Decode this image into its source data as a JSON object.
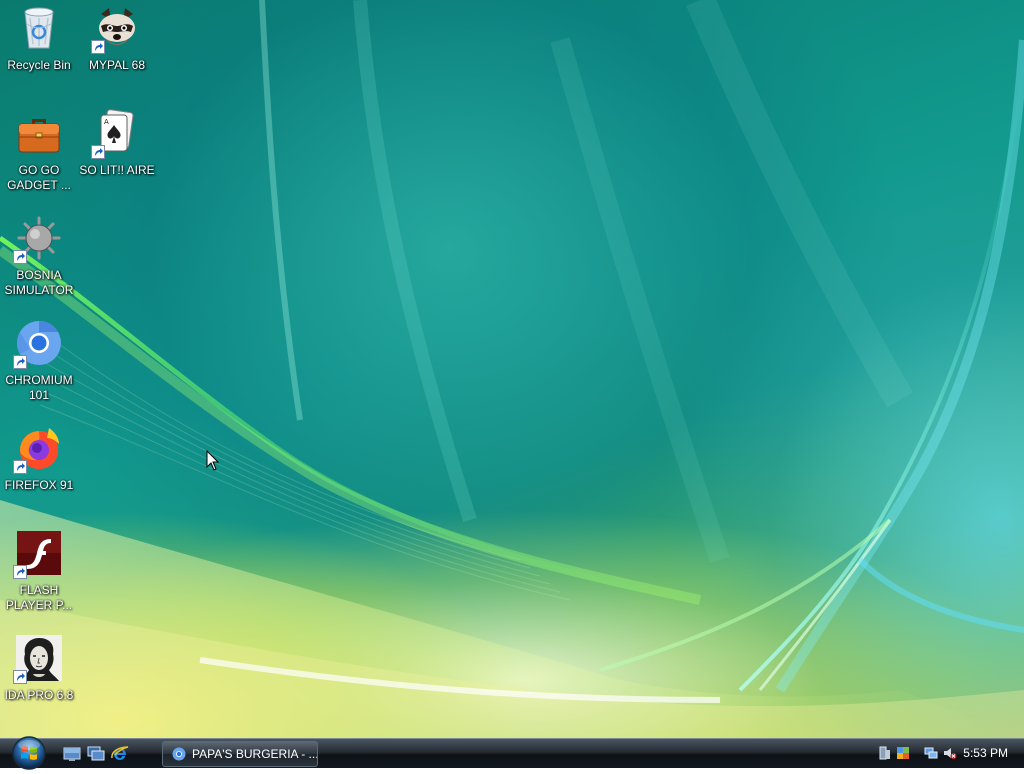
{
  "desktop_icons": [
    {
      "label": "Recycle Bin",
      "icon": "recycle-bin-icon",
      "shortcut": false
    },
    {
      "label": "MYPAL 68",
      "icon": "raccoon-icon",
      "shortcut": true
    },
    {
      "label": "GO GO\nGADGET ...",
      "icon": "briefcase-icon",
      "shortcut": false
    },
    {
      "label": "SO LIT!! AIRE",
      "icon": "playing-cards-icon",
      "shortcut": true
    },
    {
      "label": "BOSNIA\nSIMULATOR",
      "icon": "spiked-mine-icon",
      "shortcut": true
    },
    {
      "label": "CHROMIUM\n101",
      "icon": "chromium-icon",
      "shortcut": true
    },
    {
      "label": "FIREFOX 91",
      "icon": "firefox-icon",
      "shortcut": true
    },
    {
      "label": "FLASH\nPLAYER P...",
      "icon": "flash-player-icon",
      "shortcut": true
    },
    {
      "label": "IDA PRO 6.8",
      "icon": "ida-portrait-icon",
      "shortcut": true
    }
  ],
  "taskbar": {
    "start_button": "start-orb-icon",
    "quick_launch": [
      "show-desktop-icon",
      "switch-windows-icon",
      "internet-explorer-icon"
    ],
    "task_button": {
      "label": "PAPA'S BURGERIA - ...",
      "icon": "chromium-icon"
    },
    "tray_icons": [
      "network-adapter-icon",
      "tray-app-icon",
      "network-icon",
      "volume-muted-icon"
    ],
    "clock": "5:53 PM"
  },
  "colors": {
    "wallpaper_teal": "#0d8a80",
    "wallpaper_yellow": "#d6d04a",
    "taskbar": "#121820"
  }
}
